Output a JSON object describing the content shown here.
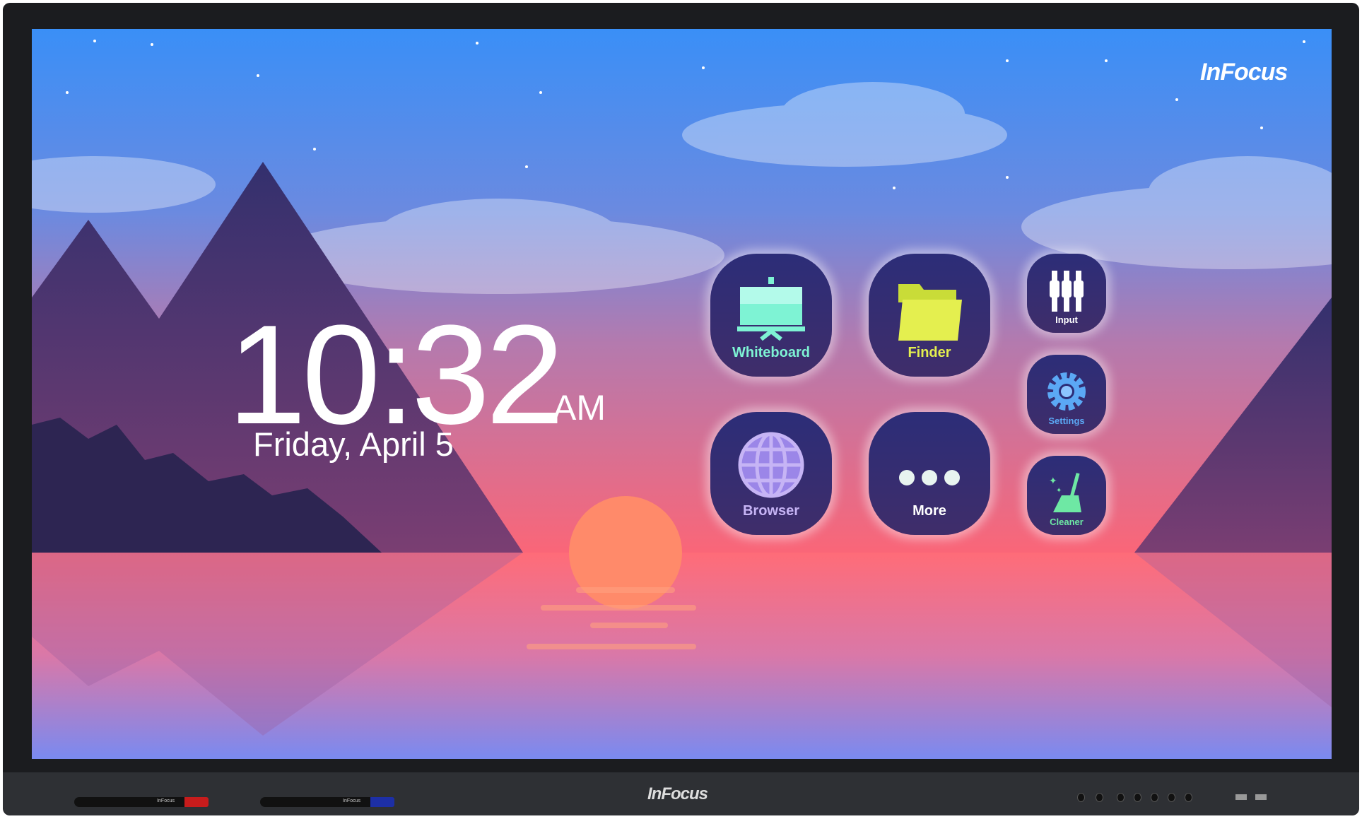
{
  "clock": {
    "time": "10:32",
    "ampm": "AM",
    "date": "Friday, April 5"
  },
  "brand": {
    "logo_top": "InFocus",
    "logo_bezel": "InFocus",
    "pen_red": "InFocus",
    "pen_blue": "InFocus"
  },
  "apps": [
    {
      "label": "Whiteboard",
      "icon": "whiteboard-easel-icon",
      "color": "#7ef3d4"
    },
    {
      "label": "Finder",
      "icon": "folder-icon",
      "color": "#e4ef4f"
    },
    {
      "label": "Browser",
      "icon": "globe-icon",
      "color": "#c6b4f5"
    },
    {
      "label": "More",
      "icon": "more-dots-icon",
      "color": "#ffffff"
    },
    {
      "label": "Input",
      "icon": "input-cables-icon",
      "color": "#ffffff"
    },
    {
      "label": "Settings",
      "icon": "gear-icon",
      "color": "#5ba8f5"
    },
    {
      "label": "Cleaner",
      "icon": "broom-icon",
      "color": "#6ee8a4"
    }
  ]
}
